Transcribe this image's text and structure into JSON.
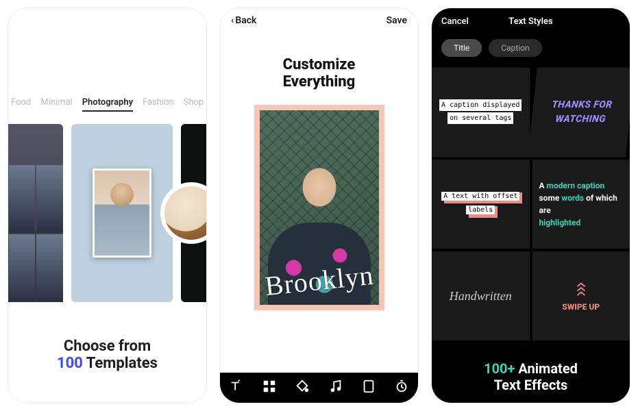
{
  "screen1": {
    "tabs": [
      "Food",
      "Minimal",
      "Photography",
      "Fashion",
      "Shop"
    ],
    "active_tab_index": 2,
    "caption_pre": "Choose from",
    "caption_accent": "100",
    "caption_post": " Templates"
  },
  "screen2": {
    "back_label": "Back",
    "save_label": "Save",
    "title_line1": "Customize",
    "title_line2": "Everything",
    "overlay_text": "Brooklyn",
    "tools": [
      "text-icon",
      "layout-icon",
      "fill-icon",
      "music-icon",
      "aspect-icon",
      "timer-icon"
    ]
  },
  "screen3": {
    "cancel": "Cancel",
    "title": "Text Styles",
    "pills": [
      "Title",
      "Caption"
    ],
    "active_pill_index": 0,
    "tiles": {
      "tag_line1": "A caption displayed",
      "tag_line2": "on several tags",
      "watch_line1": "THANKS FOR",
      "watch_line2": "WATCHING",
      "offset_line1": "A text with offset",
      "offset_line2": "labels",
      "modern_a": "A ",
      "modern_b": "modern caption",
      "modern_c": "some ",
      "modern_d": "words",
      "modern_e": " of which are",
      "modern_f": "highlighted",
      "hand": "Handwritten",
      "swipe": "SWIPE UP"
    },
    "footer_accent": "100+",
    "footer_line1": " Animated",
    "footer_line2": "Text Effects"
  }
}
